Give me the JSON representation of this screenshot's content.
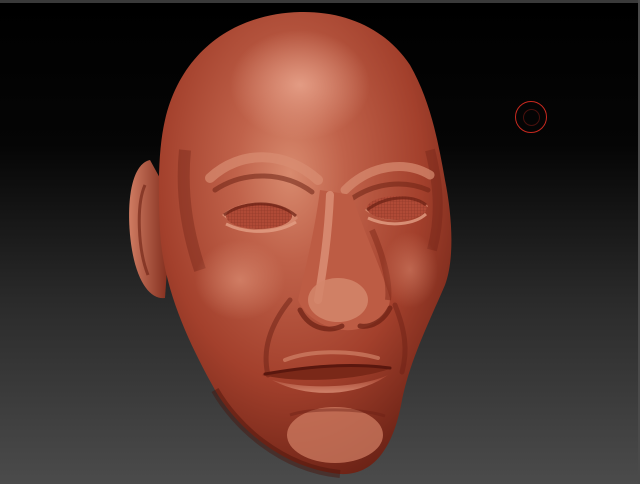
{
  "viewport": {
    "background_top": "#000000",
    "background_bottom": "#4b4b4b",
    "material_color": "#b24a34",
    "highlight_color": "#d47c62",
    "shadow_color": "#5a170e",
    "cursor_color": "#c8291f"
  },
  "model": {
    "icon": "sculpted-head-icon"
  },
  "brush_cursor": {
    "icon": "brush-cursor-icon"
  }
}
